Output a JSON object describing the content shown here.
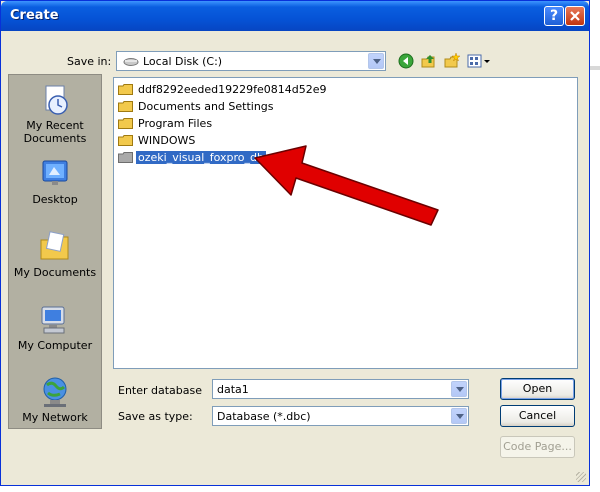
{
  "dialog": {
    "title": "Create",
    "save_in_label": "Save in:",
    "save_in_value": "Local Disk (C:)"
  },
  "places": [
    {
      "label": "My Recent Documents",
      "icon": "recent-documents-icon"
    },
    {
      "label": "Desktop",
      "icon": "desktop-icon"
    },
    {
      "label": "My Documents",
      "icon": "my-documents-icon"
    },
    {
      "label": "My Computer",
      "icon": "my-computer-icon"
    },
    {
      "label": "My Network",
      "icon": "my-network-icon"
    }
  ],
  "files": [
    {
      "name": "ddf8292eeded19229fe0814d52e9",
      "selected": false
    },
    {
      "name": "Documents and Settings",
      "selected": false
    },
    {
      "name": "Program Files",
      "selected": false
    },
    {
      "name": "WINDOWS",
      "selected": false
    },
    {
      "name": "ozeki_visual_foxpro_db",
      "selected": true
    }
  ],
  "form": {
    "enter_database_label": "Enter database",
    "enter_database_value": "data1",
    "save_as_type_label": "Save as type:",
    "save_as_type_value": "Database (*.dbc)"
  },
  "buttons": {
    "open": "Open",
    "cancel": "Cancel",
    "code_page": "Code Page..."
  },
  "colors": {
    "selection": "#316ac5",
    "annotation_arrow": "#e00000",
    "titlebar": "#0553d6"
  }
}
